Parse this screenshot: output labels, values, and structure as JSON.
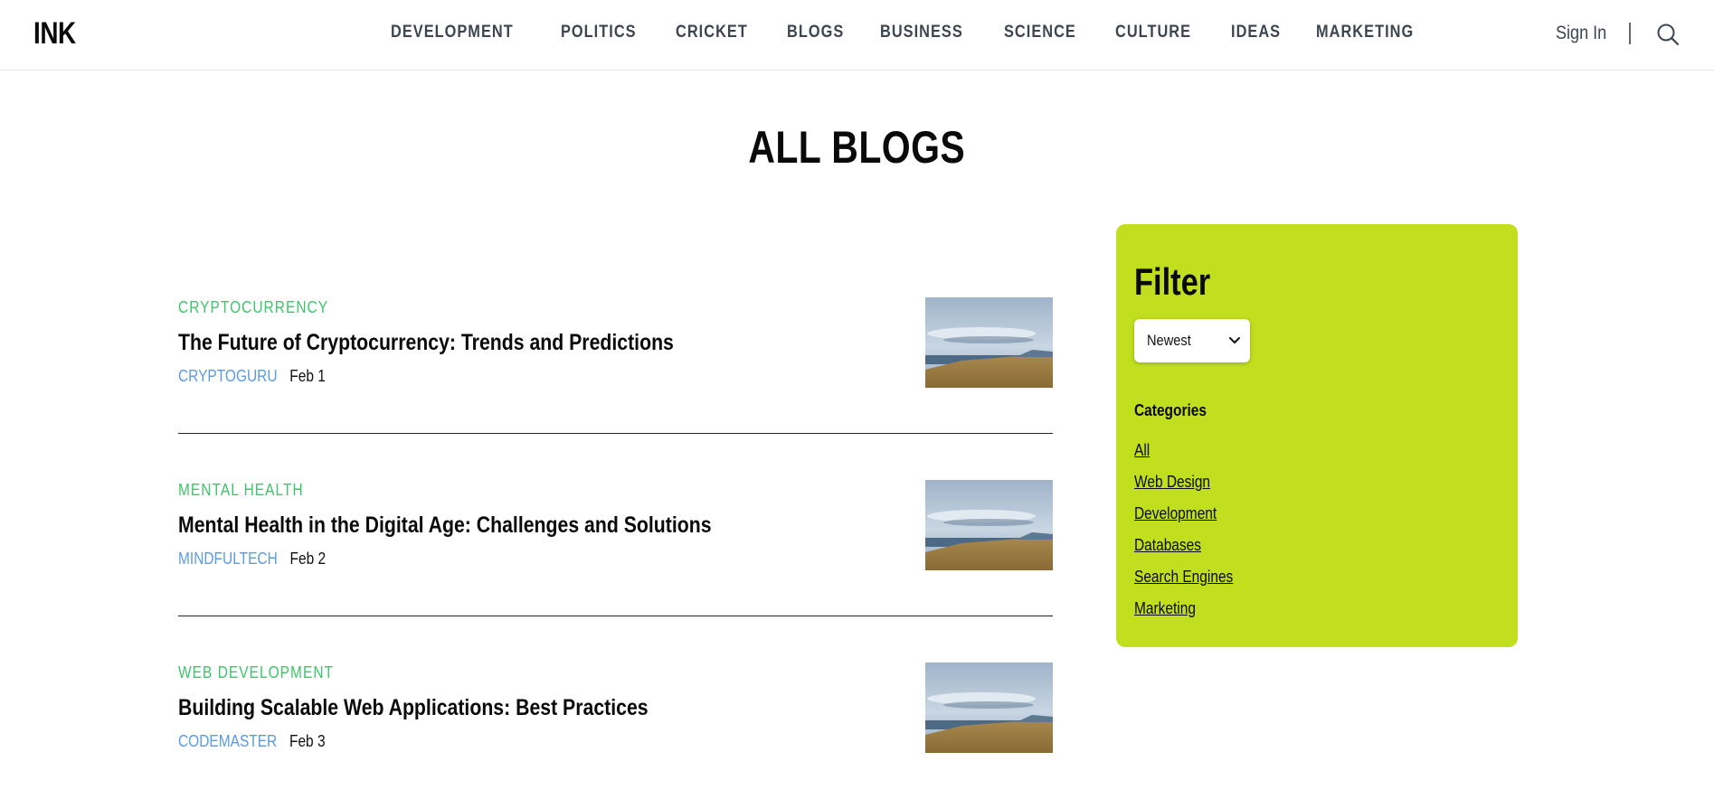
{
  "header": {
    "logo": "INK",
    "nav": [
      "DEVELOPMENT",
      "POLITICS",
      "CRICKET",
      "BLOGS",
      "BUSINESS",
      "SCIENCE",
      "CULTURE",
      "IDEAS",
      "MARKETING"
    ],
    "sign_in": "Sign In",
    "search_icon": "search-icon"
  },
  "main": {
    "title": "ALL BLOGS",
    "posts": [
      {
        "category": "CRYPTOCURRENCY",
        "title": "The Future of Cryptocurrency: Trends and Predictions",
        "author": "CRYPTOGURU",
        "date": "Feb 1"
      },
      {
        "category": "MENTAL HEALTH",
        "title": "Mental Health in the Digital Age: Challenges and Solutions",
        "author": "MINDFULTECH",
        "date": "Feb 2"
      },
      {
        "category": "WEB DEVELOPMENT",
        "title": "Building Scalable Web Applications: Best Practices",
        "author": "CODEMASTER",
        "date": "Feb 3"
      }
    ]
  },
  "filter": {
    "title": "Filter",
    "sort_selected": "Newest",
    "categories_heading": "Categories",
    "categories": [
      "All",
      "Web Design",
      "Development",
      "Databases",
      "Search Engines",
      "Marketing"
    ]
  },
  "colors": {
    "accent_panel": "#c1df1f",
    "category_green": "#3ec46b",
    "author_blue": "#5a9be6",
    "nav_text": "#3d4550"
  }
}
